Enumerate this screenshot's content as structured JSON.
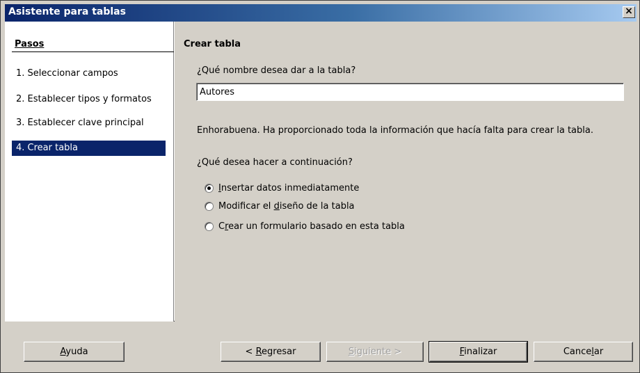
{
  "window": {
    "title": "Asistente para tablas",
    "close_glyph": "×"
  },
  "steps": {
    "header": "Pasos",
    "items": [
      {
        "label": "1. Seleccionar campos"
      },
      {
        "label": "2. Establecer tipos y formatos"
      },
      {
        "label": "3. Establecer clave principal"
      },
      {
        "label": "4. Crear tabla"
      }
    ]
  },
  "main": {
    "title": "Crear tabla",
    "name_question": "¿Qué nombre desea dar a la tabla?",
    "name_value": "Autores",
    "congrats": "Enhorabuena. Ha proporcionado toda la información que hacía falta para crear la tabla.",
    "next_question": "¿Qué desea hacer a continuación?",
    "options": [
      {
        "pre": "",
        "u": "I",
        "post": "nsertar datos inmediatamente",
        "checked": true
      },
      {
        "pre": "Modificar el ",
        "u": "d",
        "post": "iseño de la tabla",
        "checked": false
      },
      {
        "pre": "C",
        "u": "r",
        "post": "ear un formulario basado en esta tabla",
        "checked": false
      }
    ]
  },
  "buttons": {
    "help": {
      "pre": "",
      "u": "A",
      "post": "yuda"
    },
    "back": {
      "pre": "< ",
      "u": "R",
      "post": "egresar"
    },
    "next": {
      "pre": "",
      "u": "S",
      "post": "iguiente >"
    },
    "finish": {
      "pre": "",
      "u": "F",
      "post": "inalizar"
    },
    "cancel": {
      "pre": "Cance",
      "u": "l",
      "post": "ar"
    }
  }
}
